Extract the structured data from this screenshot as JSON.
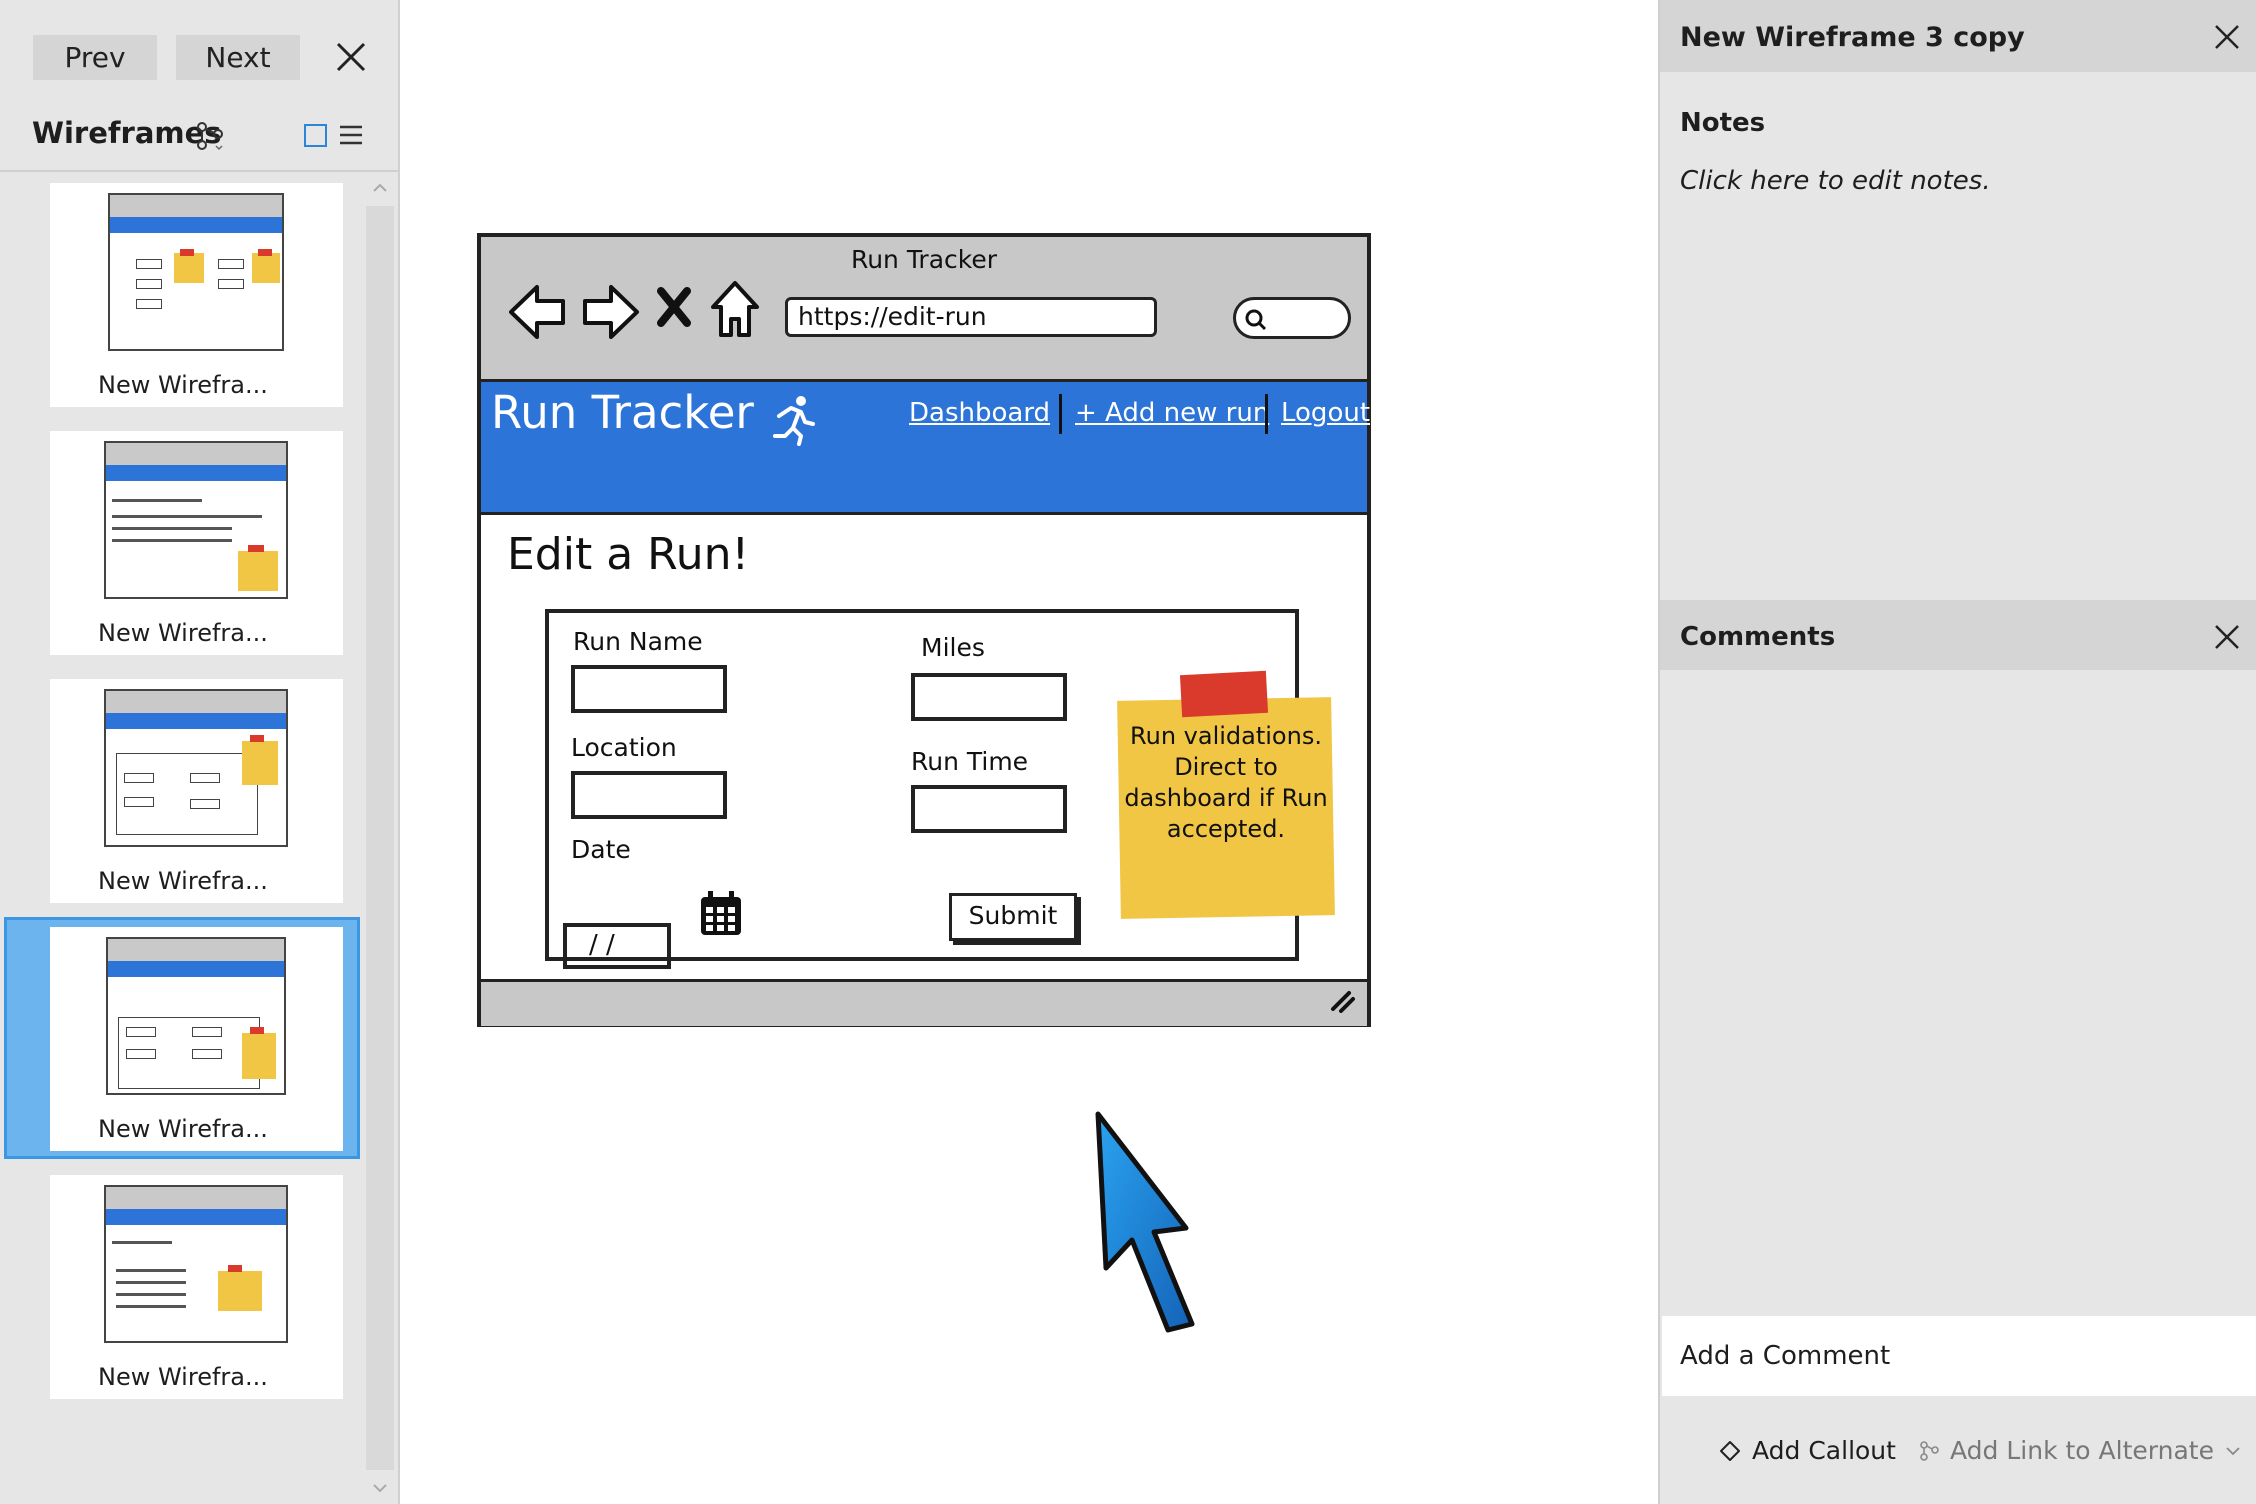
{
  "left_panel": {
    "prev_label": "Prev",
    "next_label": "Next",
    "title": "Wireframes",
    "thumbnails": [
      {
        "label": "New Wirefra..."
      },
      {
        "label": "New Wirefra..."
      },
      {
        "label": "New Wirefra..."
      },
      {
        "label": "New Wirefra..."
      },
      {
        "label": "New Wirefra..."
      }
    ],
    "selected_index": 3
  },
  "mockup": {
    "window_title": "Run Tracker",
    "url": "https://edit-run",
    "brand": "Run Tracker",
    "nav_links": [
      "Dashboard",
      "+ Add new run",
      "Logout"
    ],
    "heading": "Edit a Run!",
    "form": {
      "run_name_label": "Run Name",
      "location_label": "Location",
      "date_label": "Date",
      "date_value": "/ /",
      "miles_label": "Miles",
      "run_time_label": "Run Time",
      "submit_label": "Submit"
    },
    "sticky_note": "Run validations. Direct to dashboard if Run accepted.",
    "colors": {
      "nav": "#2d74d8",
      "sticky": "#f0c644",
      "tape": "#d93a2b"
    }
  },
  "right_panel": {
    "title": "New Wireframe 3 copy",
    "notes_heading": "Notes",
    "notes_placeholder": "Click here to edit notes.",
    "comments_heading": "Comments",
    "add_comment": "Add a Comment",
    "add_callout": "Add Callout",
    "add_link": "Add Link to Alternate"
  },
  "icons": [
    "close-icon",
    "branch-icon",
    "grid-view-icon",
    "list-view-icon",
    "back-arrow-icon",
    "forward-arrow-icon",
    "stop-icon",
    "home-icon",
    "search-icon",
    "runner-icon",
    "calendar-icon",
    "resize-grip-icon",
    "cursor-arrow-icon",
    "callout-icon",
    "link-icon",
    "chevron-down-icon"
  ]
}
